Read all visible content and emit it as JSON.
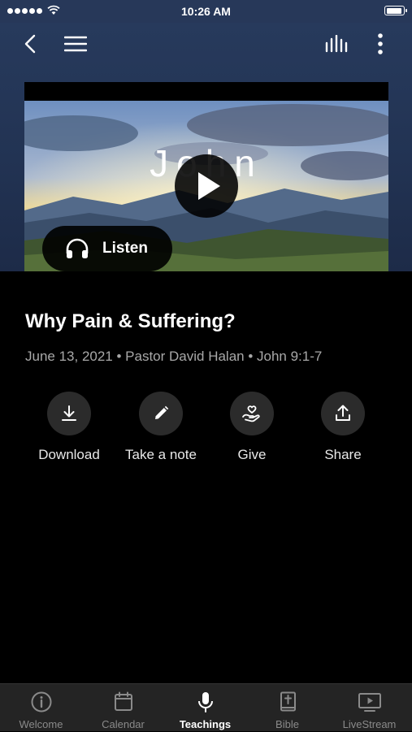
{
  "status_bar": {
    "time": "10:26 AM"
  },
  "header": {
    "icons": [
      "back-icon",
      "menu-icon",
      "audio-bars-icon",
      "more-vertical-icon"
    ]
  },
  "video": {
    "overlay_title": "John",
    "listen_label": "Listen"
  },
  "sermon": {
    "title": "Why Pain & Suffering?",
    "meta": "June 13, 2021 • Pastor David Halan • John 9:1-7"
  },
  "actions": [
    {
      "label": "Download",
      "icon": "download-icon"
    },
    {
      "label": "Take a note",
      "icon": "pencil-icon"
    },
    {
      "label": "Give",
      "icon": "give-hand-heart-icon"
    },
    {
      "label": "Share",
      "icon": "share-upload-icon"
    }
  ],
  "tabs": [
    {
      "label": "Welcome",
      "icon": "info-icon",
      "active": false
    },
    {
      "label": "Calendar",
      "icon": "calendar-icon",
      "active": false
    },
    {
      "label": "Teachings",
      "icon": "microphone-icon",
      "active": true
    },
    {
      "label": "Bible",
      "icon": "bible-icon",
      "active": false
    },
    {
      "label": "LiveStream",
      "icon": "tv-play-icon",
      "active": false
    }
  ],
  "colors": {
    "header_bg": "#273a5c",
    "background": "#000000",
    "tabbar_bg": "#242424",
    "active_tab": "#ffffff",
    "inactive_tab": "#8a8a8a"
  }
}
